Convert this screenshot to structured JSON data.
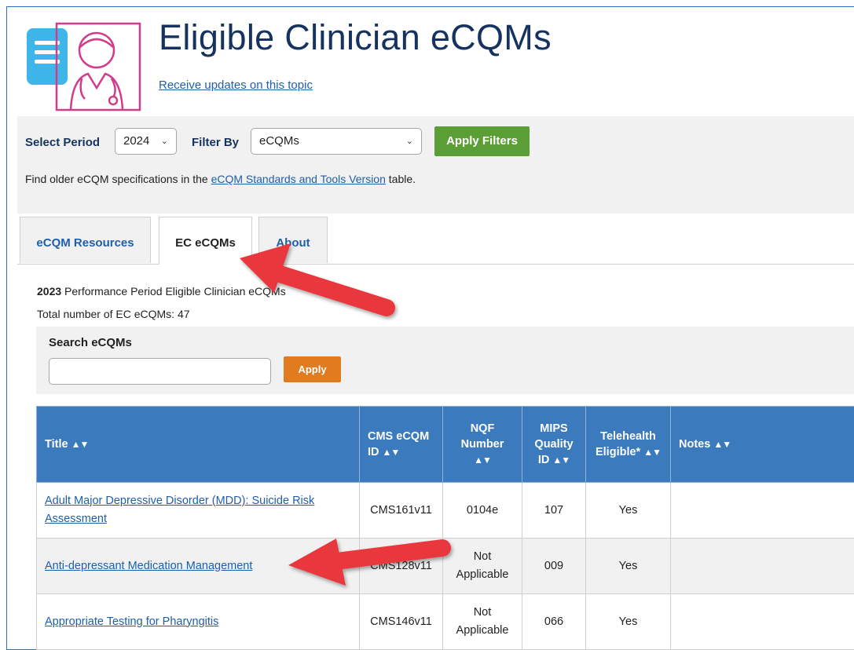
{
  "header": {
    "title": "Eligible Clinician eCQMs",
    "subscribe_link": "Receive updates on this topic",
    "logo_icon": "clinician-document-icon"
  },
  "filters": {
    "period_label": "Select Period",
    "period_value": "2024",
    "filter_label": "Filter By",
    "filter_value": "eCQMs",
    "apply_label": "Apply Filters",
    "note_prefix": "Find older eCQM specifications in the ",
    "note_link": "eCQM Standards and Tools Version",
    "note_suffix": " table."
  },
  "tabs": [
    {
      "label": "eCQM Resources",
      "active": false
    },
    {
      "label": "EC eCQMs",
      "active": true
    },
    {
      "label": "About",
      "active": false
    }
  ],
  "summary": {
    "year": "2023",
    "period_text": " Performance Period Eligible Clinician eCQMs",
    "total_text": "Total number of EC eCQMs: 47"
  },
  "search": {
    "label": "Search eCQMs",
    "input_value": "",
    "button_label": "Apply"
  },
  "table": {
    "columns": [
      "Title",
      "CMS eCQM ID",
      "NQF Number",
      "MIPS Quality ID",
      "Telehealth Eligible*",
      "Notes"
    ],
    "rows": [
      {
        "title": "Adult Major Depressive Disorder (MDD): Suicide Risk Assessment",
        "cms_id": "CMS161v11",
        "nqf": "0104e",
        "mips": "107",
        "telehealth": "Yes",
        "notes": ""
      },
      {
        "title": "Anti-depressant Medication Management",
        "cms_id": "CMS128v11",
        "nqf": "Not Applicable",
        "mips": "009",
        "telehealth": "Yes",
        "notes": ""
      },
      {
        "title": "Appropriate Testing for Pharyngitis",
        "cms_id": "CMS146v11",
        "nqf": "Not Applicable",
        "mips": "066",
        "telehealth": "Yes",
        "notes": ""
      }
    ]
  },
  "colors": {
    "header_blue": "#3b7bbd",
    "apply_green": "#5a9e35",
    "apply_orange": "#e07c1f",
    "annotation_red": "#e8393c"
  }
}
